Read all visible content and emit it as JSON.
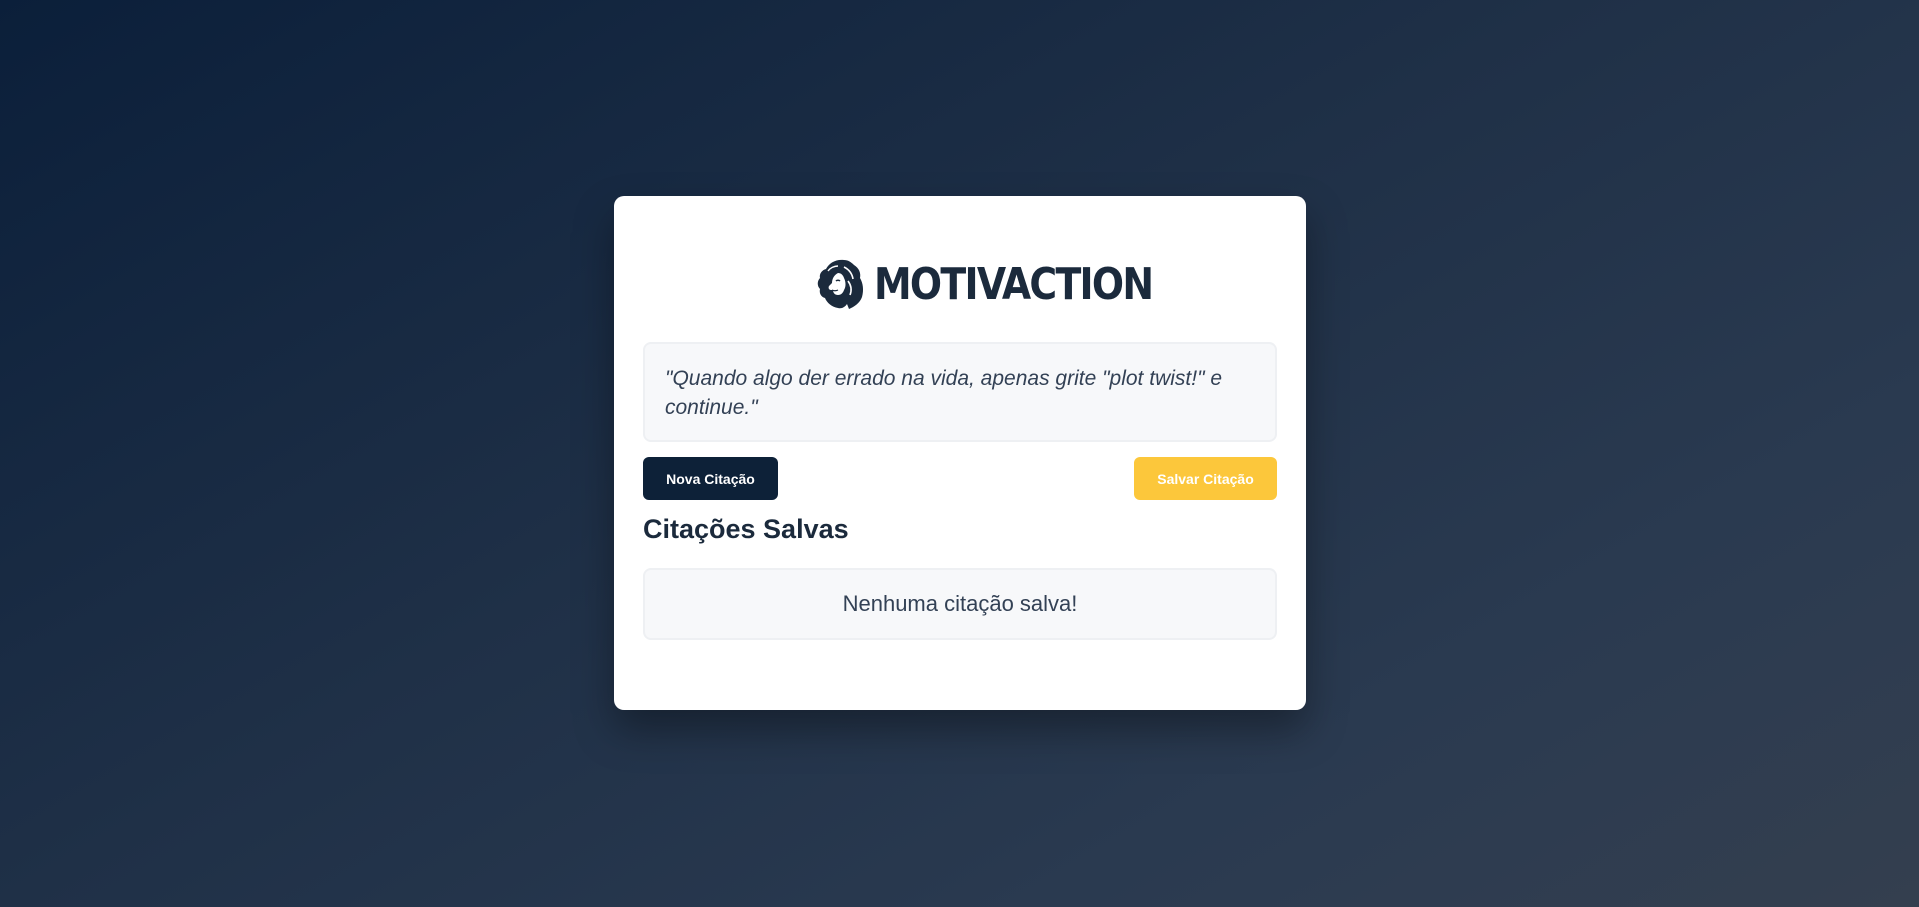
{
  "brand": {
    "name": "MOTIVACTION",
    "logo_icon": "lion-head-icon"
  },
  "quote": {
    "text": "\"Quando algo der errado na vida, apenas grite \"plot twist!\" e continue.\""
  },
  "actions": {
    "new_label": "Nova Citação",
    "save_label": "Salvar Citação"
  },
  "saved": {
    "title": "Citações Salvas",
    "empty_message": "Nenhuma citação salva!"
  },
  "colors": {
    "primary": "#0d2138",
    "accent": "#fcc73b",
    "background_start": "#0b1f3a",
    "background_end": "#343f4f",
    "text": "#1b2a3c"
  }
}
